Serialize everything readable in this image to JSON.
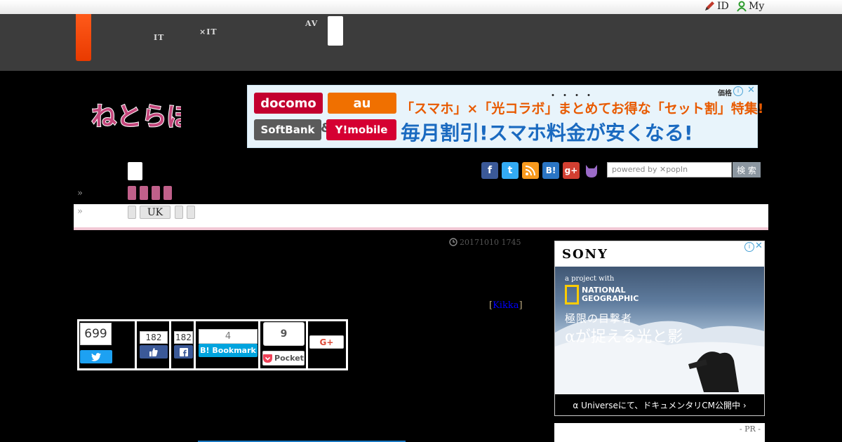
{
  "topbar": {
    "id_label": "ID",
    "my_label": "My"
  },
  "globalnav": {
    "item1_line1": "　　",
    "item1_line2": "IT",
    "item2_line1": "　　　",
    "item2_line2": "×IT",
    "item3_line1": "AV",
    "item3_line2": "　　"
  },
  "logo": {
    "text": "ねとらぼ"
  },
  "ad": {
    "btn_docomo": "docomo",
    "btn_au": "au",
    "btn_softbank": "SoftBank",
    "amp": "&",
    "btn_ymobile": "Y!mobile",
    "price_label": "価格",
    "dots": "・・・・",
    "headline1": "「スマホ」×「光コラボ」まとめてお得な「セット割」特集!",
    "headline2": "毎月割引!スマホ料金が安くなる!"
  },
  "search": {
    "placeholder": "powered by ✕popIn",
    "button": "検 索"
  },
  "tags": {
    "uk": "UK",
    "chevron": "»"
  },
  "article": {
    "date": "20171010 1745",
    "credit_open": "[",
    "credit_name": "Kikka",
    "credit_close": "]"
  },
  "share": {
    "twitter_count": "699",
    "twitter_icon": "twitter-bird",
    "like_count": "182",
    "fb_count": "182",
    "hatena_count": "4",
    "hatena_label": "B! Bookmark",
    "pocket_count": "9",
    "pocket_label": "Pocket",
    "gplus_label": "G+"
  },
  "sony_ad": {
    "brand": "SONY",
    "tagline1": "a project with",
    "ng_line1": "NATIONAL",
    "ng_line2": "GEOGRAPHIC",
    "title1": "極限の目撃者",
    "title2": "αが捉える光と影",
    "footer": "α Universeにて、ドキュメンタリCM公開中 ›"
  },
  "pr": {
    "label": "- PR -"
  },
  "colors": {
    "nav_bg": "#3c3c3c",
    "accent_orange": "#ff5a1a",
    "pink": "#c0608a",
    "twitter": "#1da1f2",
    "facebook": "#3b5998",
    "hatena": "#00a4de",
    "pocket": "#ef4056"
  }
}
